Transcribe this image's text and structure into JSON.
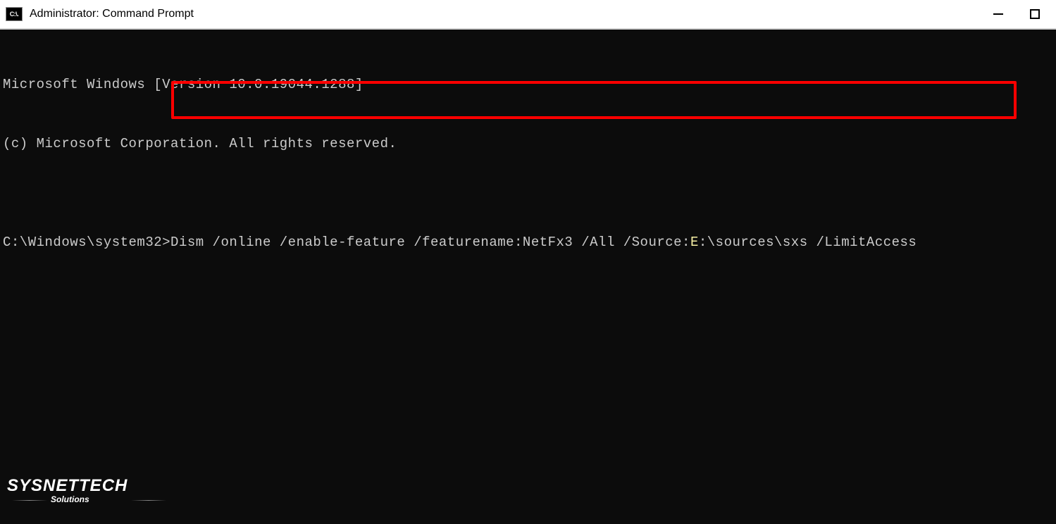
{
  "titlebar": {
    "icon_text": "C:\\.",
    "title": "Administrator: Command Prompt"
  },
  "console": {
    "line1": "Microsoft Windows [Version 10.0.19044.1288]",
    "line2": "(c) Microsoft Corporation. All rights reserved.",
    "blank": "",
    "prompt": "C:\\Windows\\system32>",
    "command_pre": "Dism /online /enable-feature /featurename:NetFx3 /All /Source:",
    "command_drive": "E",
    "command_post": ":\\sources\\sxs /LimitAccess"
  },
  "watermark": {
    "main": "SYSNETTECH",
    "sub": "Solutions"
  }
}
